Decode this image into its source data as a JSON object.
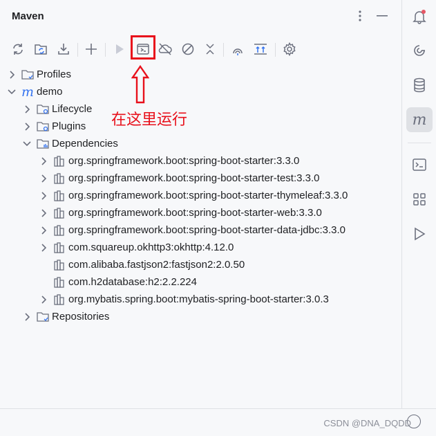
{
  "panel": {
    "title": "Maven"
  },
  "toolbar": {
    "buttons": [
      "reload-icon",
      "reimport-icon",
      "download-icon",
      "add-icon",
      "run-icon",
      "execute-goal-icon",
      "offline-icon",
      "skip-tests-icon",
      "collapse-icon",
      "analyze-icon",
      "show-deps-icon",
      "settings-icon"
    ]
  },
  "annotation": {
    "text": "在这里运行",
    "color": "#e8101b"
  },
  "tree": {
    "profiles": "Profiles",
    "project": "demo",
    "lifecycle": "Lifecycle",
    "plugins": "Plugins",
    "dependencies": "Dependencies",
    "deps": [
      "org.springframework.boot:spring-boot-starter:3.3.0",
      "org.springframework.boot:spring-boot-starter-test:3.3.0",
      "org.springframework.boot:spring-boot-starter-thymeleaf:3.3.0",
      "org.springframework.boot:spring-boot-starter-web:3.3.0",
      "org.springframework.boot:spring-boot-starter-data-jdbc:3.3.0",
      "com.squareup.okhttp3:okhttp:4.12.0",
      "com.alibaba.fastjson2:fastjson2:2.0.50",
      "com.h2database:h2:2.2.224",
      "org.mybatis.spring.boot:mybatis-spring-boot-starter:3.0.3"
    ],
    "repositories": "Repositories"
  },
  "watermark": "CSDN @DNA_DQDD",
  "accent": "#3574f0"
}
